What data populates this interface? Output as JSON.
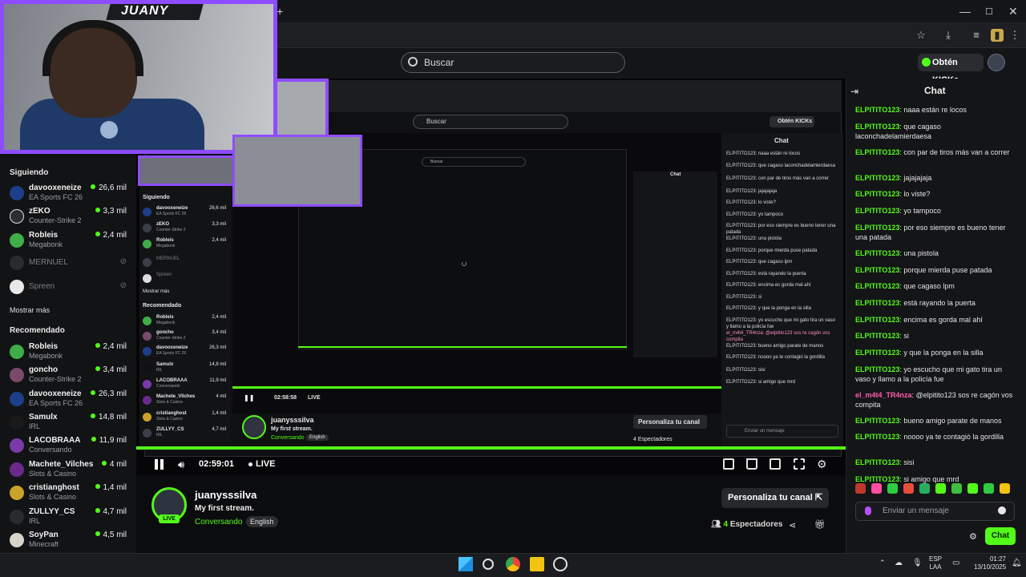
{
  "overlay": {
    "streamer_tag": "JUANY"
  },
  "browser": {
    "new_tab": "+",
    "minimize": "—",
    "maximize": "☐",
    "close": "✕"
  },
  "header": {
    "search_placeholder": "Buscar",
    "kicks_button": "Obtén KICKs"
  },
  "sidebar": {
    "following_title": "Siguiendo",
    "following": [
      {
        "name": "davooxeneize",
        "category": "EA Sports FC 26",
        "viewers": "26,6 mil"
      },
      {
        "name": "zEKO",
        "category": "Counter-Strike 2",
        "viewers": "3,3 mil"
      },
      {
        "name": "Robleis",
        "category": "Megabonk",
        "viewers": "2,4 mil"
      },
      {
        "name": "MERNUEL",
        "category": "",
        "viewers": ""
      },
      {
        "name": "Spreen",
        "category": "",
        "viewers": ""
      }
    ],
    "show_more": "Mostrar más",
    "recommended_title": "Recomendado",
    "recommended": [
      {
        "name": "Robleis",
        "category": "Megabonk",
        "viewers": "2,4 mil"
      },
      {
        "name": "goncho",
        "category": "Counter-Strike 2",
        "viewers": "3,4 mil"
      },
      {
        "name": "davooxeneize",
        "category": "EA Sports FC 26",
        "viewers": "26,3 mil"
      },
      {
        "name": "Samulx",
        "category": "IRL",
        "viewers": "14,8 mil"
      },
      {
        "name": "LACOBRAAA",
        "category": "Conversando",
        "viewers": "11,9 mil"
      },
      {
        "name": "Machete_Vilches",
        "category": "Slots & Casino",
        "viewers": "4 mil"
      },
      {
        "name": "cristianghost",
        "category": "Slots & Casino",
        "viewers": "1,4 mil"
      },
      {
        "name": "ZULLYY_CS",
        "category": "IRL",
        "viewers": "4,7 mil"
      },
      {
        "name": "SoyPan",
        "category": "Minecraft",
        "viewers": "4,5 mil"
      }
    ]
  },
  "player": {
    "time": "02:59:01",
    "live": "LIVE",
    "progress_fraction": 1.0
  },
  "nested": {
    "search_placeholder": "Buscar",
    "kicks_button": "Obtén KICKs",
    "chat_title": "Chat",
    "time": "02:58:58",
    "live": "LIVE",
    "following_title": "Siguiendo",
    "recommended_title": "Recomendado",
    "show_more": "Mostrar más",
    "streamer_name": "juanysssilva",
    "stream_title": "My first stream.",
    "category": "Conversando",
    "language": "English",
    "customize_button": "Personaliza tu canal",
    "viewers": "4 Espectadores",
    "chat_input_placeholder": "Enviar un mensaje",
    "chat_lines": [
      "ELPITITO123: naaa están re locos",
      "ELPITITO123: que cagaso laconchadelamierdaesa",
      "ELPITITO123: con par de tiros más van a correr",
      "ELPITITO123: jajajajaja",
      "ELPITITO123: lo viste?",
      "ELPITITO123: yo tampoco",
      "ELPITITO123: por eso siempre es bueno tener una patada",
      "ELPITITO123: una pistola",
      "ELPITITO123: porque mierda puse patada",
      "ELPITITO123: que cagaso lpm",
      "ELPITITO123: está rayando la puerta",
      "ELPITITO123: encima es gorda mal ahí",
      "ELPITITO123: si",
      "ELPITITO123: y que la ponga en la silla",
      "ELPITITO123: yo escucho que mi gato tira un vaso y llamo a la policía fue",
      "el_m4t4_TR4nza: @elpitito123 sos re cagón vos compita",
      "ELPITITO123: bueno amigo parate de manos",
      "ELPITITO123: noooo ya te contagió la gordilla",
      "ELPITITO123: sisi",
      "ELPITITO123: si amigo que mrd"
    ]
  },
  "stream_info": {
    "streamer_name": "juanysssilva",
    "stream_title": "My first stream.",
    "category": "Conversando",
    "language": "English",
    "live_badge": "LIVE",
    "customize_button": "Personaliza tu canal",
    "viewers_count": "4",
    "viewers_label": "Espectadores"
  },
  "chat": {
    "title": "Chat",
    "input_placeholder": "Enviar un mensaje",
    "send_button": "Chat",
    "messages": [
      {
        "user": "ELPITITO123",
        "text": "naaa están re locos"
      },
      {
        "user": "ELPITITO123",
        "text": "que cagaso laconchadelamierdaesa"
      },
      {
        "user": "ELPITITO123",
        "text": "con par de tiros más van a correr"
      },
      {
        "user": "ELPITITO123",
        "text": "jajajajaja"
      },
      {
        "user": "ELPITITO123",
        "text": "lo viste?"
      },
      {
        "user": "ELPITITO123",
        "text": "yo tampoco"
      },
      {
        "user": "ELPITITO123",
        "text": "por eso siempre es bueno tener una patada"
      },
      {
        "user": "ELPITITO123",
        "text": "una pistola"
      },
      {
        "user": "ELPITITO123",
        "text": "porque mierda puse patada"
      },
      {
        "user": "ELPITITO123",
        "text": "que cagaso lpm"
      },
      {
        "user": "ELPITITO123",
        "text": "está rayando la puerta"
      },
      {
        "user": "ELPITITO123",
        "text": "encima es gorda mal ahí"
      },
      {
        "user": "ELPITITO123",
        "text": "si"
      },
      {
        "user": "ELPITITO123",
        "text": "y que la ponga en la silla"
      },
      {
        "user": "ELPITITO123",
        "text": "yo escucho que mi gato tira un vaso y llamo a la policía fue"
      },
      {
        "user": "el_m4t4_TR4nza",
        "text": "@elpitito123 sos re cagón vos compita"
      },
      {
        "user": "ELPITITO123",
        "text": "bueno amigo parate de manos"
      },
      {
        "user": "ELPITITO123",
        "text": "noooo ya te contagió la gordilla"
      },
      {
        "user": "ELPITITO123",
        "text": "sisi"
      },
      {
        "user": "ELPITITO123",
        "text": "si amigo que mrd"
      }
    ]
  },
  "taskbar": {
    "lang_line1": "ESP",
    "lang_line2": "LAA",
    "time": "01:27",
    "date": "13/10/2025"
  },
  "colors": {
    "accent": "#53fc18",
    "overlay_border": "#8e4cff",
    "mention_user": "#ff5bb0"
  }
}
